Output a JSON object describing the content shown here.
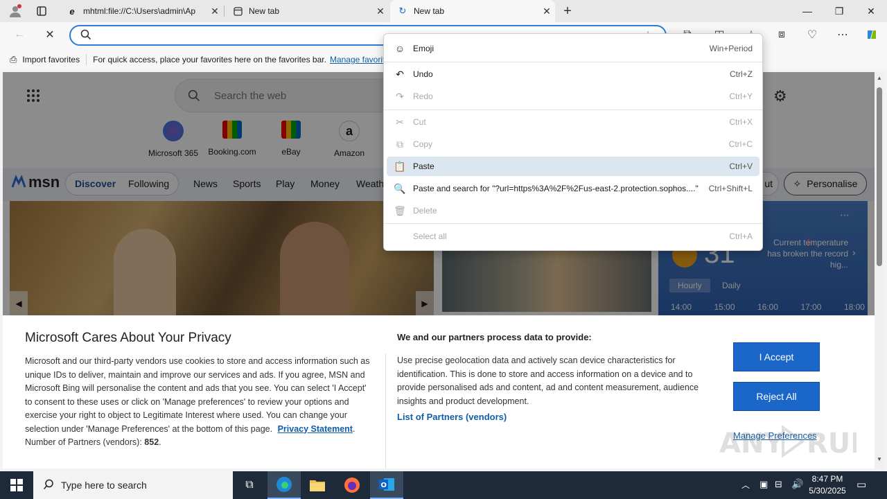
{
  "tabs": [
    {
      "title": "mhtml:file://C:\\Users\\admin\\Ap"
    },
    {
      "title": "New tab"
    },
    {
      "title": "New tab"
    }
  ],
  "favorites_bar": {
    "import_label": "Import favorites",
    "hint": "For quick access, place your favorites here on the favorites bar.",
    "manage_link": "Manage favorit"
  },
  "newtab": {
    "search_placeholder": "Search the web",
    "quick_links": [
      {
        "label": "Microsoft 365"
      },
      {
        "label": "Booking.com"
      },
      {
        "label": "eBay"
      },
      {
        "label": "Amazon"
      }
    ],
    "msn_logo": "msn",
    "nav": [
      "Discover",
      "Following",
      "News",
      "Sports",
      "Play",
      "Money",
      "Weath"
    ],
    "layout_btn": "ut",
    "personalise_btn": "Personalise",
    "weather": {
      "temp": "31",
      "note": "Current temperature has broken the record hig...",
      "tabs": [
        "Hourly",
        "Daily"
      ],
      "hours": [
        "14:00",
        "15:00",
        "16:00",
        "17:00",
        "18:00"
      ]
    }
  },
  "context_menu": {
    "items": [
      {
        "label": "Emoji",
        "shortcut": "Win+Period",
        "icon": "emoji-icon",
        "disabled": false
      },
      {
        "label": "Undo",
        "shortcut": "Ctrl+Z",
        "icon": "undo-icon",
        "disabled": false
      },
      {
        "label": "Redo",
        "shortcut": "Ctrl+Y",
        "icon": "redo-icon",
        "disabled": true
      },
      {
        "label": "Cut",
        "shortcut": "Ctrl+X",
        "icon": "cut-icon",
        "disabled": true
      },
      {
        "label": "Copy",
        "shortcut": "Ctrl+C",
        "icon": "copy-icon",
        "disabled": true
      },
      {
        "label": "Paste",
        "shortcut": "Ctrl+V",
        "icon": "paste-icon",
        "disabled": false
      },
      {
        "label": "Paste and search for \"?url=https%3A%2F%2Fus-east-2.protection.sophos....\"",
        "shortcut": "Ctrl+Shift+L",
        "icon": "paste-search-icon",
        "disabled": false
      },
      {
        "label": "Delete",
        "shortcut": "",
        "icon": "delete-icon",
        "disabled": true
      },
      {
        "label": "Select all",
        "shortcut": "Ctrl+A",
        "icon": "",
        "disabled": true
      }
    ]
  },
  "privacy": {
    "title": "Microsoft Cares About Your Privacy",
    "body": "Microsoft and our third-party vendors use cookies to store and access information such as unique IDs to deliver, maintain and improve our services and ads. If you agree, MSN and Microsoft Bing will personalise the content and ads that you see. You can select 'I Accept' to consent to these uses or click on 'Manage preferences' to review your options and exercise your right to object to Legitimate Interest where used.  You can change your selection under 'Manage Preferences' at the bottom of this page.",
    "privacy_link": "Privacy Statement",
    "partners_label": "Number of Partners (vendors):",
    "partners_count": "852",
    "right_title": "We and our partners process data to provide:",
    "right_body": "Use precise geolocation data and actively scan device characteristics for identification. This is done to store and access information on a device and to provide personalised ads and content, ad and content measurement, audience insights and product development.",
    "partners_link": "List of Partners (vendors)",
    "accept": "I Accept",
    "reject": "Reject All",
    "manage": "Manage Preferences"
  },
  "taskbar": {
    "search_placeholder": "Type here to search",
    "time": "8:47 PM",
    "date": "5/30/2025"
  },
  "colors": {
    "accent": "#1b66c9",
    "link": "#0f5da8",
    "address_border": "#2f7ad6"
  }
}
